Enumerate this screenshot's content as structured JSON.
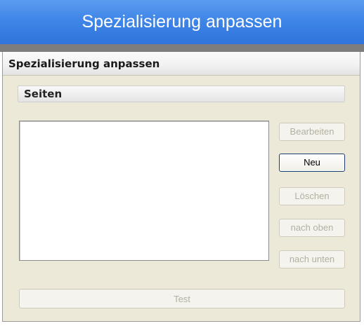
{
  "banner": {
    "title": "Spezialisierung anpassen"
  },
  "dialog": {
    "title": "Spezialisierung anpassen",
    "group_label": "Seiten",
    "list_items": [],
    "buttons": {
      "edit": "Bearbeiten",
      "new": "Neu",
      "delete": "Löschen",
      "move_up": "nach oben",
      "move_down": "nach unten",
      "test": "Test"
    }
  },
  "colors": {
    "banner": "#3f86e8",
    "dialog_bg": "#ece9d8",
    "disabled_text": "#b3b09f"
  }
}
